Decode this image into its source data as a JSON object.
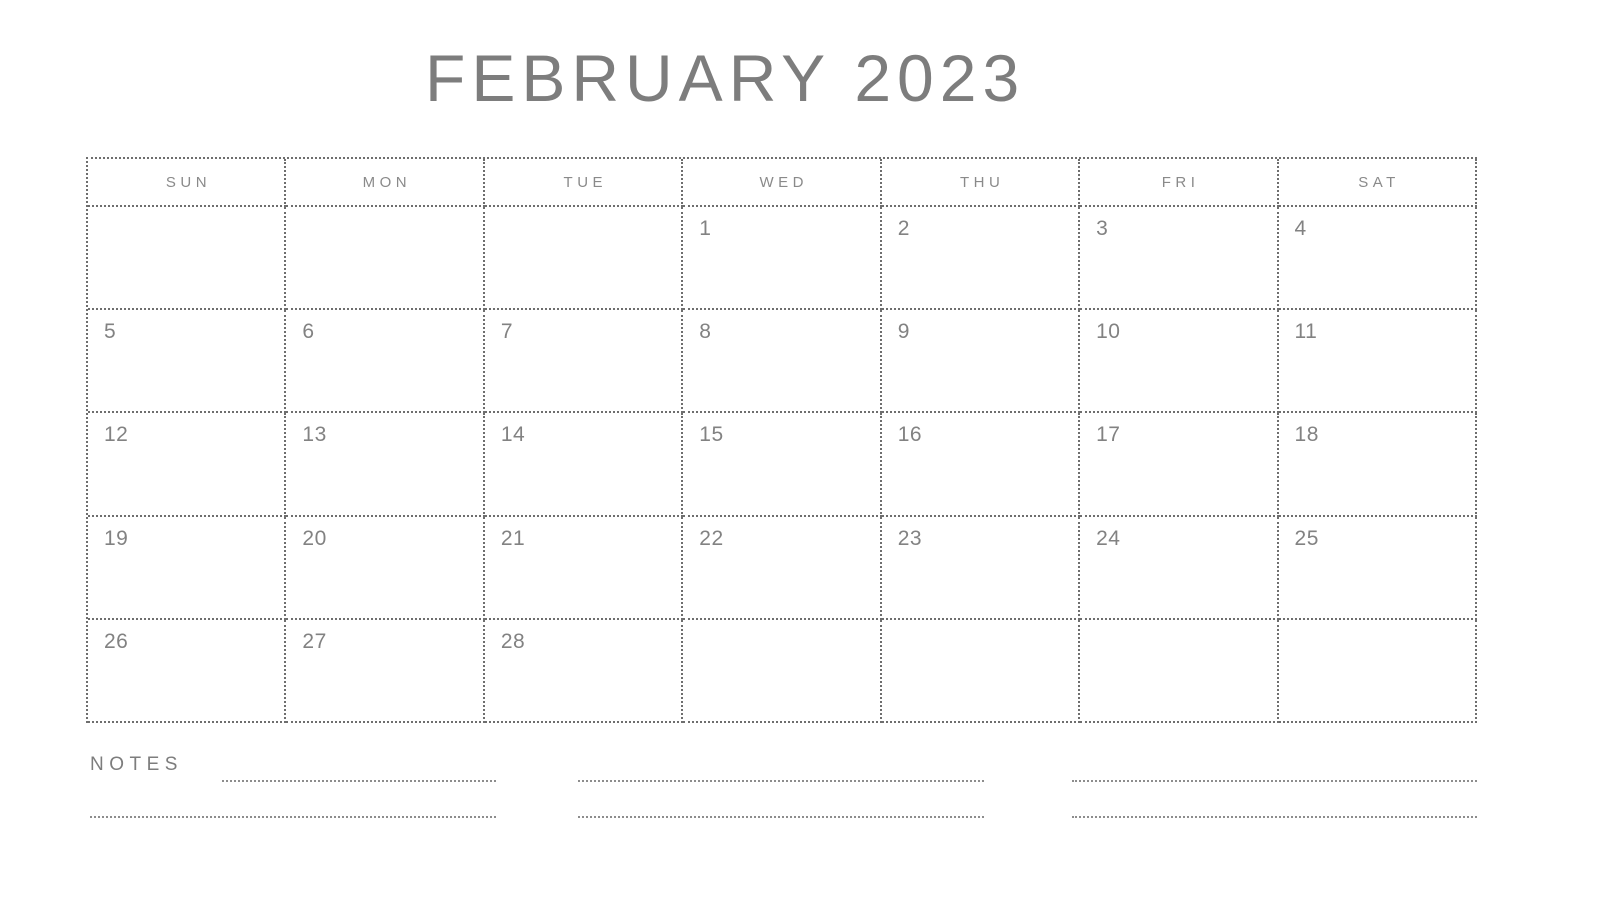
{
  "title": "FEBRUARY 2023",
  "month": "FEBRUARY",
  "year": "2023",
  "colors": {
    "background": "#ffffff",
    "title_text": "#7d7d7d",
    "weekday_text": "#8a8a8a",
    "day_number_text": "#828282",
    "grid_line": "#6e6e6e",
    "notes_line": "#8d8d8d"
  },
  "calendar": {
    "weekdays": [
      "SUN",
      "MON",
      "TUE",
      "WED",
      "THU",
      "FRI",
      "SAT"
    ],
    "weeks": [
      [
        "",
        "",
        "",
        "1",
        "2",
        "3",
        "4"
      ],
      [
        "5",
        "6",
        "7",
        "8",
        "9",
        "10",
        "11"
      ],
      [
        "12",
        "13",
        "14",
        "15",
        "16",
        "17",
        "18"
      ],
      [
        "19",
        "20",
        "21",
        "22",
        "23",
        "24",
        "25"
      ],
      [
        "26",
        "27",
        "28",
        "",
        "",
        "",
        ""
      ]
    ]
  },
  "notes": {
    "label": "NOTES",
    "line_count": 6,
    "columns": 3,
    "rows": 2
  }
}
